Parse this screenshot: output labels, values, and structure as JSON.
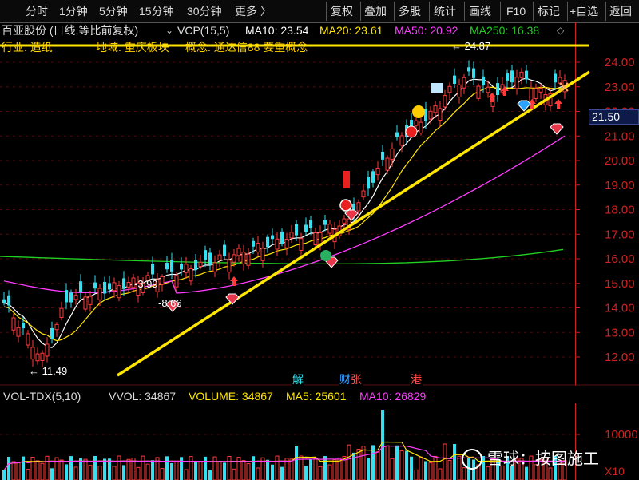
{
  "toolbar": {
    "left_items": [
      "分时",
      "1分钟",
      "5分钟",
      "15分钟",
      "30分钟",
      "更多 〉"
    ],
    "right_items": [
      "复权",
      "叠加",
      "多股",
      "统计",
      "画线",
      "F10",
      "标记",
      "+自选",
      "返回"
    ]
  },
  "info": {
    "stock": "百亚股份 (日线,等比前复权)",
    "indicator": "VCP(15,5)",
    "ma10": "MA10: 23.54",
    "ma20": "MA20: 23.61",
    "ma50": "MA50: 20.92",
    "ma250": "MA250: 16.38"
  },
  "industry": {
    "industry": "行业: 造纸",
    "region": "地域: 重庆板块",
    "concept": "概念: 通达信88 要重概念"
  },
  "price_axis": {
    "labels": [
      "24.00",
      "23.00",
      "22.00",
      "21.00",
      "20.00",
      "19.00",
      "18.00",
      "17.00",
      "16.00",
      "15.00",
      "14.00",
      "13.00",
      "12.00"
    ],
    "current": "21.50"
  },
  "annotations": {
    "high": "24.87",
    "low": "11.49",
    "mark1": "-3.99",
    "mark2": "-8.66",
    "tag_jie": "解",
    "tag_cai": "财",
    "tag_zhang": "张",
    "tag_gang": "港"
  },
  "volume": {
    "indicator": "VOL-TDX(5,10)",
    "vvol": "VVOL: 34867",
    "volume": "VOLUME: 34867",
    "ma5": "MA5: 25601",
    "ma10": "MA10: 26829",
    "axis_label": "10000",
    "unit": "X10"
  },
  "watermark": {
    "text": "雪球：按图施工"
  },
  "colors": {
    "up": "#ff3b3b",
    "down": "#35e0f0",
    "ma10": "#ffffff",
    "ma20": "#ffe600",
    "ma50": "#ff3cff",
    "ma250": "#22d022",
    "trendline": "#ffe600",
    "axis": "#d02020"
  },
  "chart_data": {
    "type": "candlestick",
    "ylim": [
      11.5,
      24.8
    ],
    "y_ticks": [
      24,
      23,
      22,
      21,
      20,
      19,
      18,
      17,
      16,
      15,
      14,
      13,
      12
    ],
    "current_price": 21.5,
    "high_marker": 24.87,
    "low_marker": 11.49,
    "series": [
      {
        "name": "MA10",
        "value": 23.54
      },
      {
        "name": "MA20",
        "value": 23.61
      },
      {
        "name": "MA50",
        "value": 20.92
      },
      {
        "name": "MA250",
        "value": 16.38
      }
    ]
  }
}
